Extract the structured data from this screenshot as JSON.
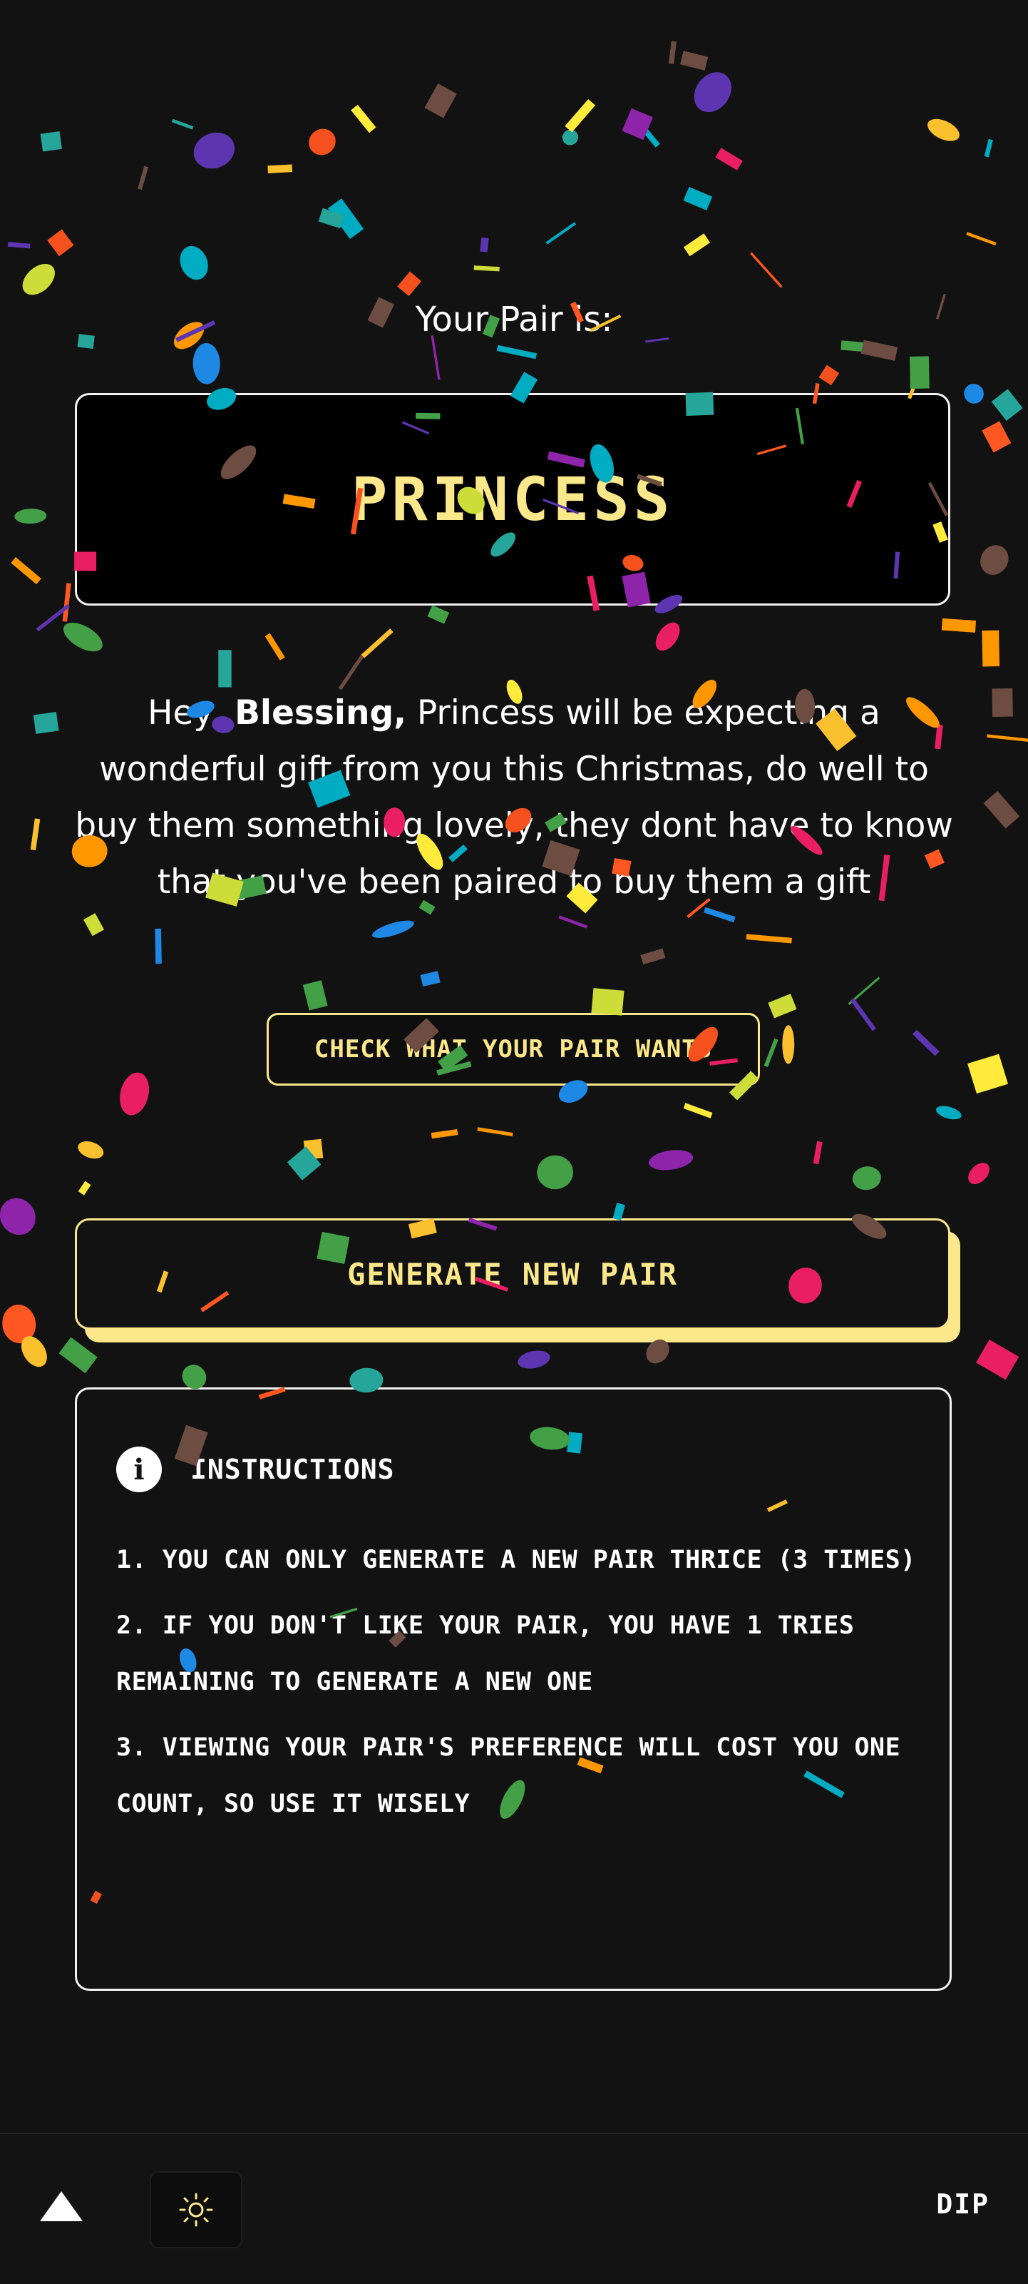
{
  "pair": {
    "heading": "Your Pair is:",
    "name": "PRINCESS"
  },
  "message": {
    "greeting": "Hey,",
    "user_name": "Blessing,",
    "text": "Princess will be expecting a wonderful gift from you this Christmas, do well to buy them something lovely, they dont have to know that you've been paired to buy them a gift"
  },
  "actions": {
    "check_wants_label": "CHECK WHAT YOUR PAIR WANTS",
    "generate_label": "GENERATE NEW PAIR"
  },
  "instructions": {
    "title": "INSTRUCTIONS",
    "info_icon": "i",
    "items": [
      "1. YOU CAN ONLY GENERATE A NEW PAIR THRICE (3 TIMES)",
      "2. IF YOU DON'T LIKE YOUR PAIR, YOU HAVE 1 TRIES REMAINING TO GENERATE A NEW ONE",
      "3. VIEWING YOUR PAIR'S PREFERENCE WILL COST YOU ONE COUNT, SO USE IT WISELY"
    ]
  },
  "footer": {
    "logo_icon": "triangle-logo-icon",
    "theme_icon": "sun-icon",
    "brand": "DIP"
  },
  "colors": {
    "accent": "#fbe88b",
    "background": "#121212",
    "confetti": [
      "#ff5722",
      "#1e88e5",
      "#fbc02d",
      "#8e24aa",
      "#43a047",
      "#e91e63",
      "#00acc1",
      "#6d4c41",
      "#cddc39",
      "#5e35b1",
      "#ff9800",
      "#f4511e",
      "#ffeb3b",
      "#26a69a"
    ]
  }
}
